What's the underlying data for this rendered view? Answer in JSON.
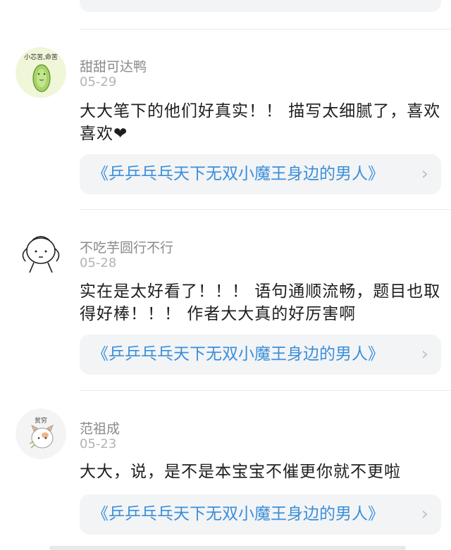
{
  "book_title": "《乒乒乓乓天下无双小魔王身边的男人》",
  "chevron": "›",
  "comments": [
    {
      "username": "甜甜可达鸭",
      "date": "05-29",
      "content": "大大笔下的他们好真实！！ 描写太细腻了，喜欢喜欢❤",
      "avatar_text": "小芯苦,命苦",
      "avatar_icon": "cucumber-icon"
    },
    {
      "username": "不吃芋圆行不行",
      "date": "05-28",
      "content": "实在是太好看了！！！ 语句通顺流畅，题目也取得好棒！！！ 作者大大真的好厉害啊",
      "avatar_icon": "doodle-face-icon"
    },
    {
      "username": "范祖成",
      "date": "05-23",
      "content": "大大，说，是不是本宝宝不催更你就不更啦",
      "avatar_text": "贫穷",
      "avatar_icon": "cat-sticker-icon"
    }
  ]
}
